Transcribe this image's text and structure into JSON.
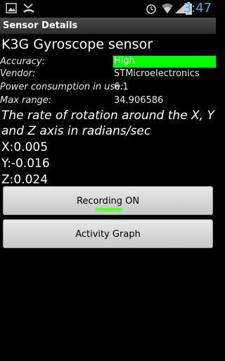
{
  "status_bar": {
    "time": "3:47",
    "icons": [
      "image-icon",
      "missed-call-icon",
      "alarm-icon",
      "wifi-icon",
      "signal-icon",
      "battery-icon"
    ]
  },
  "title_bar": {
    "title": "Sensor Details"
  },
  "sensor": {
    "name": "K3G Gyroscope sensor",
    "accuracy_label": "Accuracy:",
    "accuracy_value": "High",
    "vendor_label": "Vendor:",
    "vendor_value": "STMicroelectronics",
    "power_label": "Power consumption in use:",
    "power_value": "6.1",
    "max_range_label": "Max range:",
    "max_range_value": "34.906586",
    "description": "The rate of rotation around the X, Y and Z axis in radians/sec",
    "x": "X:0.005",
    "y": "Y:-0.016",
    "z": "Z:0.024"
  },
  "buttons": {
    "recording": "Recording ON",
    "activity_graph": "Activity Graph"
  },
  "colors": {
    "accuracy_high": "#00ff00",
    "clock": "#33b5e5",
    "recording_indicator": "#5cff33"
  }
}
